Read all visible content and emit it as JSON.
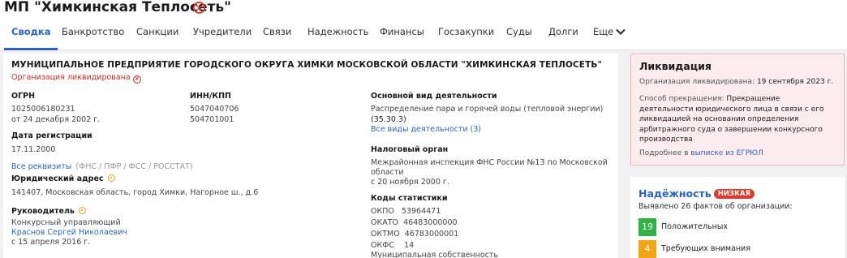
{
  "company": {
    "title": "МП \"Химкинская Теплосеть\"",
    "full_name": "МУНИЦИПАЛЬНОЕ ПРЕДПРИЯТИЕ ГОРОДСКОГО ОКРУГА ХИМКИ МОСКОВСКОЙ ОБЛАСТИ \"ХИМКИНСКАЯ ТЕПЛОСЕТЬ\"",
    "status": "Организация ликвидирована"
  },
  "tabs": [
    "Сводка",
    "Банкротство",
    "Санкции",
    "Учредители",
    "Связи",
    "Надежность",
    "Финансы",
    "Госзакупки",
    "Суды",
    "Долги",
    "Еще"
  ],
  "ogrn": {
    "label": "ОГРН",
    "value": "1025006180231",
    "date": "от 24 декабря 2002 г."
  },
  "inn": {
    "label": "ИНН/КПП",
    "value": "5047040706",
    "kpp": "504701001"
  },
  "activity": {
    "label": "Основной вид деятельности",
    "value": "Распределение пара и горячей воды (тепловой энергии)",
    "code": "(35.30.3)",
    "link": "Все виды деятельности (3)"
  },
  "registration": {
    "label": "Дата регистрации",
    "value": "17.11.2000",
    "link": "Все реквизиты",
    "sources": "(ФНС / ПФР / ФСС / РОССТАТ)"
  },
  "tax": {
    "label": "Налоговый орган",
    "line1": "Межрайонная инспекция ФНС России №13 по Московской",
    "line2": "области",
    "date": "с 20 ноября 2000 г."
  },
  "address": {
    "label": "Юридический адрес",
    "value": "141407, Московская область, город Химки, Нагорное ш., д.6"
  },
  "stats": {
    "label": "Коды статистики",
    "rows": [
      {
        "k": "ОКПО",
        "v": "53964471"
      },
      {
        "k": "ОКАТО",
        "v": "46483000000"
      },
      {
        "k": "ОКТМО",
        "v": "46783000001"
      },
      {
        "k": "ОКФС",
        "v": "14"
      }
    ],
    "ownership": "Муниципальная собственность"
  },
  "head": {
    "label": "Руководитель",
    "role": "Конкурсный управляющий",
    "name": "Краснов Сергей Николаевич",
    "since": "с 15 апреля 2016 г."
  },
  "liquidation": {
    "title": "Ликвидация",
    "date_label": "Организация ликвидирована:",
    "date_value": "19 сентября 2023 г.",
    "method_label": "Способ прекращения:",
    "method_line1": "Прекращение",
    "method_line2": "деятельности юридического лица в связи с его",
    "method_line3": "ликвидацией на основании определения",
    "method_line4": "арбитражного суда о завершении конкурсного",
    "method_line5": "производства",
    "more_prefix": "Подробнее в",
    "more_link": "выписке из ЕГРЮЛ"
  },
  "reliability": {
    "title": "Надёжность",
    "badge": "НИЗКАЯ",
    "summary": "Выявлено 26 фактов об организации:",
    "items": [
      {
        "count": "19",
        "label": "Положительных",
        "color": "#2fb344"
      },
      {
        "count": "4",
        "label": "Требующих внимания",
        "color": "#f3a514"
      }
    ]
  }
}
